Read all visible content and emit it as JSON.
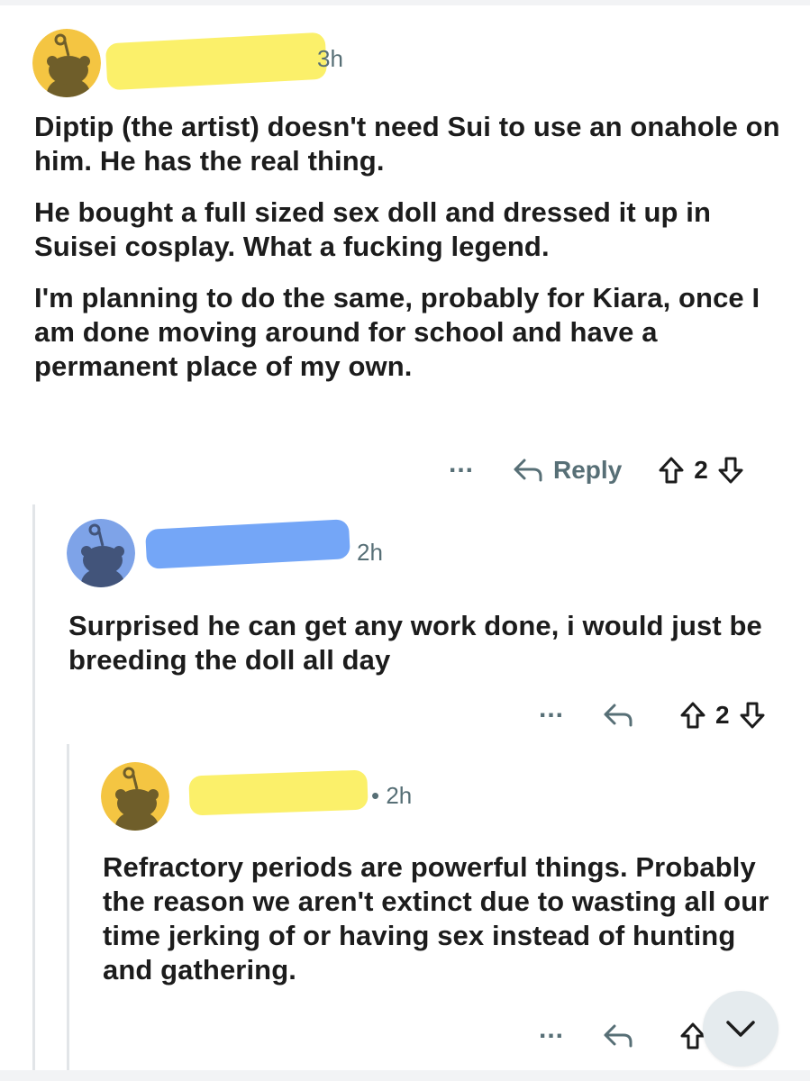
{
  "colors": {
    "avatar_yellow": "#f4c542",
    "avatar_blue": "#7ea3e8",
    "redaction_yellow": "#fbf06a",
    "redaction_blue": "#74a6f7",
    "meta_gray": "#576f76",
    "thread_line": "#e2e5e8"
  },
  "comments": [
    {
      "author": "",
      "age": "3h",
      "paragraphs": [
        "Diptip (the artist) doesn't need Sui to use an onahole on him. He has the real thing.",
        "He bought a full sized sex doll and dressed it up in Suisei cosplay. What a fucking legend.",
        "I'm planning to do the same, probably for Kiara, once I am done moving around for school and have a permanent place of my own."
      ],
      "more_icon": "ellipsis-icon",
      "reply_label": "Reply",
      "score": "2"
    },
    {
      "author": "",
      "age": "2h",
      "paragraphs": [
        "Surprised he can get any work done, i would just be breeding the doll all day"
      ],
      "more_icon": "ellipsis-icon",
      "reply_label": "",
      "score": "2"
    },
    {
      "author": "",
      "age": "• 2h",
      "paragraphs": [
        "Refractory periods are powerful things. Probably the reason we aren't extinct due to wasting all our time jerking of or having sex instead of hunting and gathering."
      ],
      "more_icon": "ellipsis-icon",
      "reply_label": "",
      "score": ""
    }
  ],
  "icons": {
    "reply": "reply-arrow-icon",
    "upvote": "upvote-arrow-icon",
    "downvote": "downvote-arrow-icon",
    "scroll": "chevron-down-icon"
  }
}
